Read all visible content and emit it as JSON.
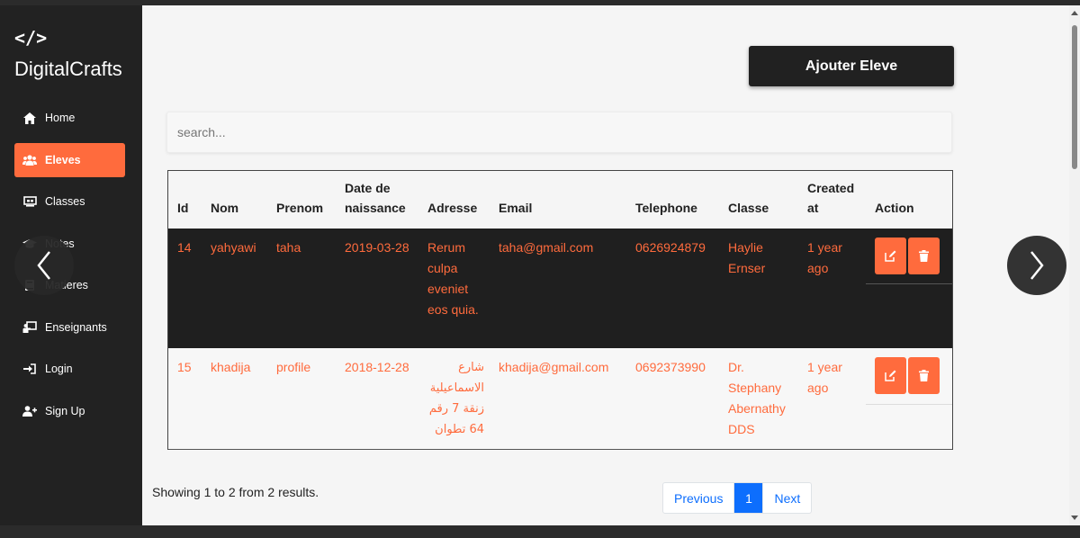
{
  "brand": {
    "icon": "</>",
    "name": "DigitalCrafts"
  },
  "sidebar": {
    "items": [
      {
        "label": "Home",
        "icon": "home-icon",
        "active": false
      },
      {
        "label": "Eleves",
        "icon": "users-icon",
        "active": true
      },
      {
        "label": "Classes",
        "icon": "classroom-icon",
        "active": false
      },
      {
        "label": "Notes",
        "icon": "graduation-cap-icon",
        "active": false
      },
      {
        "label": "Matieres",
        "icon": "book-icon",
        "active": false
      },
      {
        "label": "Enseignants",
        "icon": "teacher-board-icon",
        "active": false
      },
      {
        "label": "Login",
        "icon": "sign-in-icon",
        "active": false
      },
      {
        "label": "Sign Up",
        "icon": "user-plus-icon",
        "active": false
      }
    ]
  },
  "toolbar": {
    "add_label": "Ajouter Eleve"
  },
  "search": {
    "placeholder": "search..."
  },
  "table": {
    "headers": [
      "Id",
      "Nom",
      "Prenom",
      "Date de naissance",
      "Adresse",
      "Email",
      "Telephone",
      "Classe",
      "Created at",
      "Action"
    ],
    "rows": [
      {
        "id": "14",
        "nom": "yahyawi",
        "prenom": "taha",
        "date": "2019-03-28",
        "adresse": "Rerum culpa eveniet eos quia.",
        "email": "taha@gmail.com",
        "telephone": "0626924879",
        "classe": "Haylie Ernser",
        "created": "1 year ago"
      },
      {
        "id": "15",
        "nom": "khadija",
        "prenom": "profile",
        "date": "2018-12-28",
        "adresse": "شارع الاسماعيلية زنقة 7 رقم 64 تطوان",
        "email": "khadija@gmail.com",
        "telephone": "0692373990",
        "classe": "Dr. Stephany Abernathy DDS",
        "created": "1 year ago"
      }
    ]
  },
  "footer": {
    "showing": "Showing 1 to 2 from 2 results."
  },
  "pagination": {
    "previous": "Previous",
    "current": "1",
    "next": "Next"
  },
  "colors": {
    "accent": "#ff6b3d",
    "sidebar_bg": "#222222",
    "link": "#0d6efd"
  }
}
